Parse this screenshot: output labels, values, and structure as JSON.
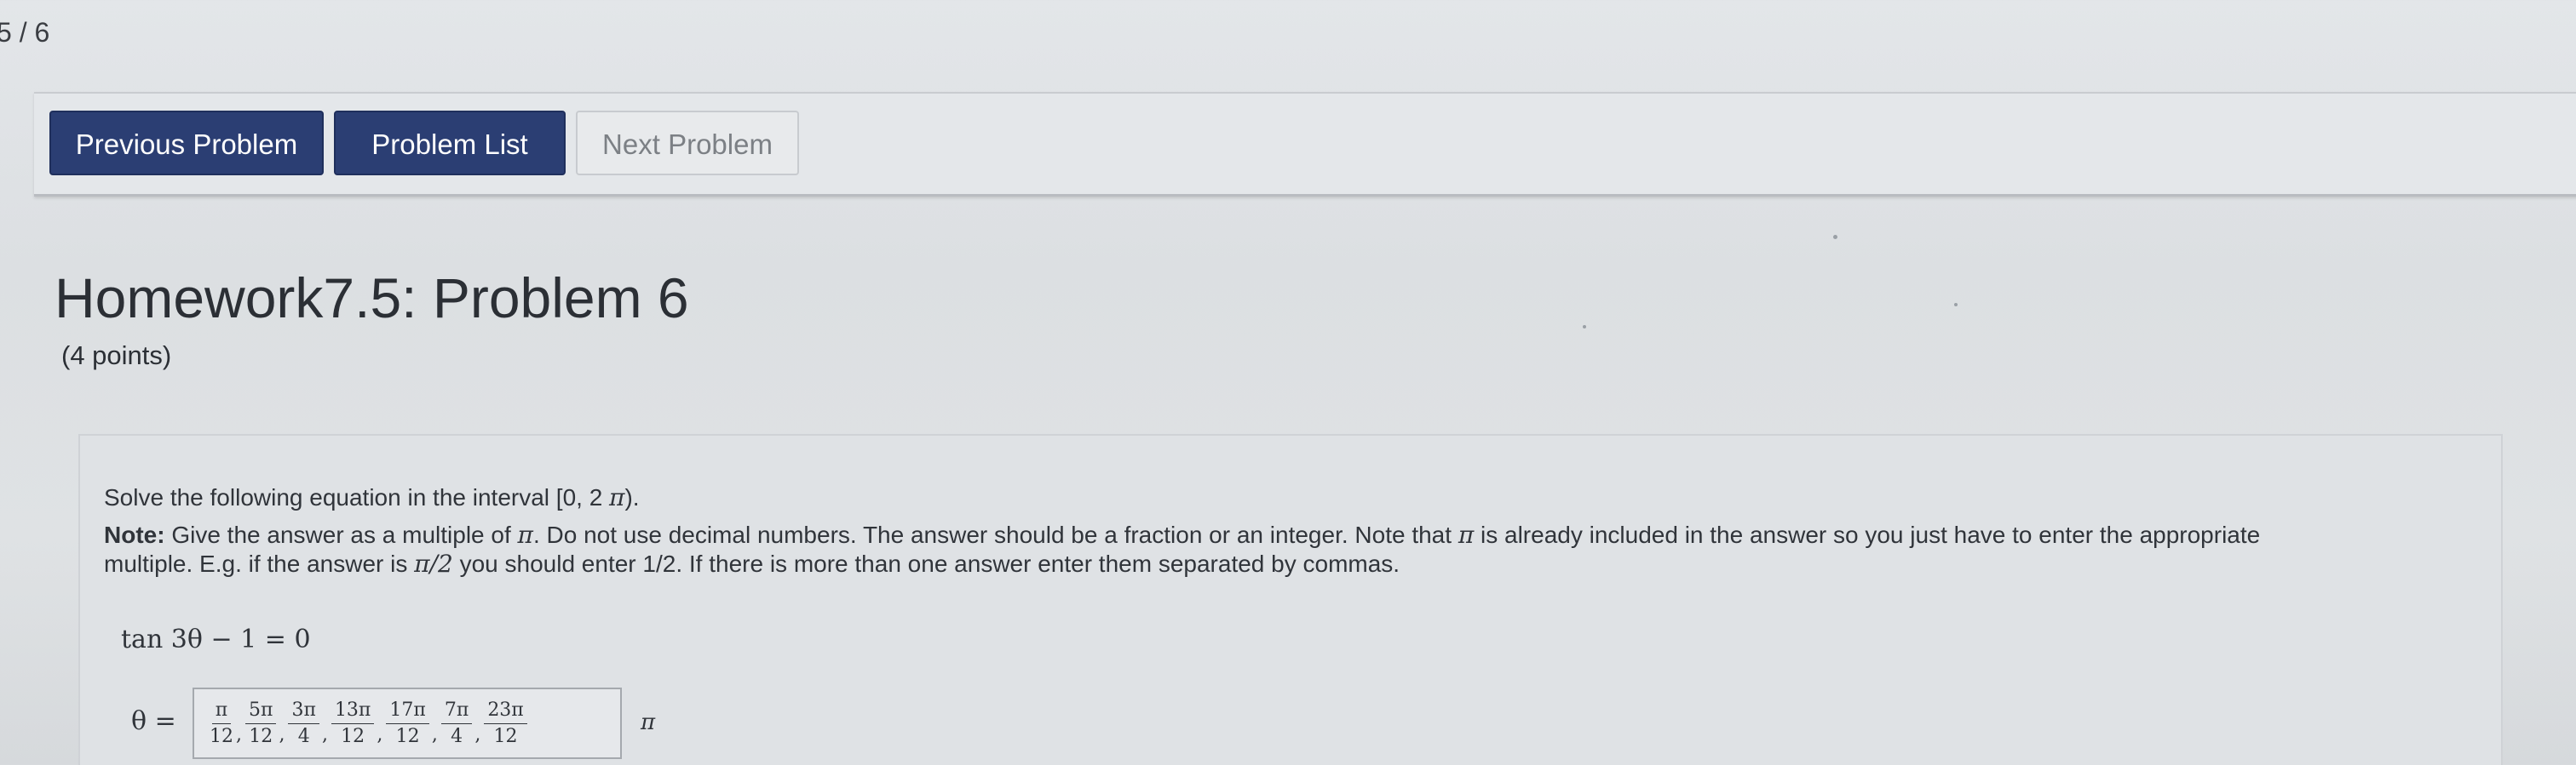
{
  "page_counter": "5 / 6",
  "nav": {
    "previous_label": "Previous Problem",
    "list_label": "Problem List",
    "next_label": "Next Problem"
  },
  "problem": {
    "title": "Homework7.5: Problem 6",
    "points": "(4 points)",
    "line1_prefix": "Solve the following equation in the interval [0, 2 ",
    "line1_pi": "π",
    "line1_suffix": ").",
    "note_label": "Note:",
    "note_text_a": " Give the answer as a multiple of ",
    "note_pi": "π",
    "note_text_b": ". Do not use decimal numbers. The answer should be a fraction or an integer. Note that ",
    "note_pi2": "π",
    "note_text_c": " is already included in the answer so you just have to enter the appropriate",
    "line3_prefix": "multiple. E.g. if the answer is ",
    "line3_math": "π/2",
    "line3_suffix": " you should enter 1/2. If there is more than one answer enter them separated by commas.",
    "equation": "tan 3θ − 1 = 0",
    "answer_label": "θ =",
    "answer_unit": "π",
    "answer_fractions": [
      {
        "num": "π",
        "den": "12"
      },
      {
        "num": "5π",
        "den": "12"
      },
      {
        "num": "3π",
        "den": "4"
      },
      {
        "num": "13π",
        "den": "12"
      },
      {
        "num": "17π",
        "den": "12"
      },
      {
        "num": "7π",
        "den": "4"
      },
      {
        "num": "23π",
        "den": "12"
      }
    ],
    "separator": ","
  }
}
